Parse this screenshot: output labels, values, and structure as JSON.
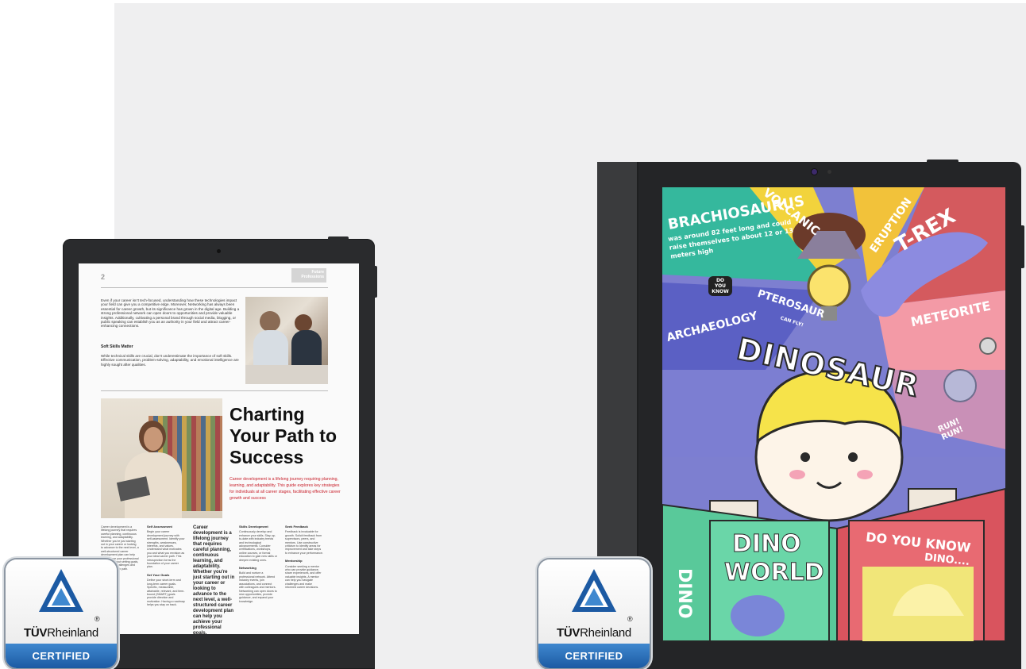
{
  "left_tablet": {
    "page_number": "2",
    "page_tag": "Future Professions",
    "intro_paragraph": "Even if your career isn't tech-focused, understanding how these technologies impact your field can give you a competitive edge. Moreover, Networking has always been essential for career growth, but its significance has grown in the digital age. Building a strong professional network can open doors to opportunities and provide valuable insights. Additionally, cultivating a personal brand through social media, blogging, or public speaking can establish you as an authority in your field and attract career-enhancing connections.",
    "soft_skills_heading": "Soft Skills Matter",
    "soft_skills_paragraph": "While technical skills are crucial, don't underestimate the importance of soft skills. Effective communication, problem-solving, adaptability, and emotional intelligence are highly sought after qualities.",
    "headline": "Charting Your Path to Success",
    "intro_red": "Career development is a lifelong journey requiring planning, learning, and adaptability. This guide explores key strategies for individuals at all career stages, facilitating effective career growth and success",
    "columns": [
      {
        "heading": "",
        "text": "Career development is a lifelong journey that requires careful planning, continuous learning, and adaptability. Whether you're just starting out in your career or looking to advance to the next level, a well-structured career development plan can help you achieve your professional goals. It's about setting goals, adapting to challenges and taking your own path."
      },
      {
        "heading": "Self Assessment",
        "text": "Begin your career development journey with self-assessment. Identify your strengths, weaknesses, interests, and values. Understand what motivates you and what you envision as your ideal career path. This introspection forms the foundation of your career plan."
      },
      {
        "heading": "",
        "text": "Career development is a lifelong journey that requires careful planning, continuous learning, and adaptability. Whether you're just starting out in your career or looking to advance to the next level, a well-structured career development plan can help you achieve your professional goals."
      },
      {
        "heading": "Skills Development",
        "text": "Continuously develop and enhance your skills. Stay up-to-date with industry trends and technological advancements. Consider certifications, workshops, online courses, or formal education to gain new skills or deepen existing ones."
      },
      {
        "heading": "Seek Feedback",
        "text": "Feedback is invaluable for growth. Solicit feedback from supervisors, peers, and mentors. Use constructive criticism to identify areas for improvement and take steps to enhance your performance."
      }
    ],
    "set_goals_heading": "Set Your Goals",
    "set_goals_text": "Define your short-term and long-term career goals. Specific, measurable, attainable, relevant, and time-bound (SMART) goals provide direction and motivation. Having a roadmap helps you stay on track.",
    "networking_heading": "Networking",
    "networking_text": "Build and nurture a professional network. Attend industry events, join associations, and connect with colleagues and mentors. Networking can open doors to new opportunities, provide guidance, and expand your knowledge.",
    "mentorship_heading": "Mentorship",
    "mentorship_text": "Consider seeking a mentor who can provide guidance, share experiences, and offer valuable insights. A mentor can help you navigate challenges and make informed career decisions."
  },
  "right_tablet": {
    "cover_words": {
      "brachiosaurus": "BRACHIOSAURUS",
      "brachio_note": "was around 82 feet long and could raise themselves to about 12 or 13 meters high",
      "volcanic": "VOLCANIC",
      "eruption": "ERUPTION",
      "trex": "T-REX",
      "do_you_know_small": "DO YOU KNOW",
      "pterosaur": "PTEROSAUR",
      "pterosaur_note": "CAN FLY!",
      "archaeology": "ARCHAEOLOGY",
      "meteorite": "METEORITE",
      "dinosaur": "DINOSAUR",
      "run": "RUN! RUN!",
      "dino_world_1": "DINO",
      "dino_world_2": "WORLD",
      "do_you_know": "DO YOU KNOW",
      "dino_dots": "DINO....",
      "spine": "DINO"
    }
  },
  "badges": [
    {
      "brand_bold": "TÜV",
      "brand_regular": "Rheinland",
      "registered": "®",
      "certified": "CERTIFIED"
    },
    {
      "brand_bold": "TÜV",
      "brand_regular": "Rheinland",
      "registered": "®",
      "certified": "CERTIFIED"
    }
  ],
  "colors": {
    "badge_blue": "#1c5aa3",
    "accent_red": "#c8202b",
    "device_body": "#242527"
  }
}
